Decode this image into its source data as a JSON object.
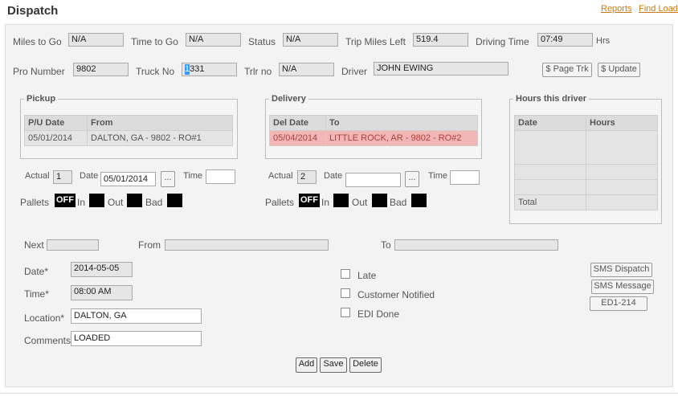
{
  "header": {
    "title": "Dispatch",
    "reports_link": "Reports",
    "find_load_link": "Find Load"
  },
  "summary": {
    "miles_to_go_label": "Miles to Go",
    "miles_to_go": "N/A",
    "time_to_go_label": "Time to Go",
    "time_to_go": "N/A",
    "status_label": "Status",
    "status": "N/A",
    "trip_miles_left_label": "Trip Miles Left",
    "trip_miles_left": "519.4",
    "driving_time_label": "Driving Time",
    "driving_time": "07:49",
    "driving_time_unit": "Hrs",
    "pro_number_label": "Pro Number",
    "pro_number": "9802",
    "truck_no_label": "Truck No",
    "truck_no_first": "1",
    "truck_no_rest": "331",
    "trlr_no_label": "Trlr no",
    "trlr_no": "N/A",
    "driver_label": "Driver",
    "driver": "JOHN EWING",
    "page_trk_button": "$ Page Trk",
    "update_button": "$ Update"
  },
  "pickup": {
    "legend": "Pickup",
    "col_date": "P/U Date",
    "col_from": "From",
    "row": {
      "date": "05/01/2014",
      "from": "DALTON, GA - 9802 - RO#1"
    },
    "actual_label": "Actual",
    "actual": "1",
    "date_label": "Date",
    "date": "05/01/2014",
    "picker_button": "...",
    "time_label": "Time",
    "time": "",
    "pallets_label": "Pallets",
    "off_text": "OFF",
    "in_label": "In",
    "out_label": "Out",
    "bad_label": "Bad"
  },
  "delivery": {
    "legend": "Delivery",
    "col_date": "Del Date",
    "col_to": "To",
    "row": {
      "date": "05/04/2014",
      "to": "LITTLE ROCK, AR - 9802 - RO#2"
    },
    "actual_label": "Actual",
    "actual": "2",
    "date_label": "Date",
    "date": "",
    "picker_button": "...",
    "time_label": "Time",
    "time": "",
    "pallets_label": "Pallets",
    "off_text": "OFF",
    "in_label": "In",
    "out_label": "Out",
    "bad_label": "Bad"
  },
  "hours": {
    "legend": "Hours this driver",
    "col_date": "Date",
    "col_hours": "Hours",
    "total_label": "Total"
  },
  "next": {
    "next_label": "Next",
    "next_value": "",
    "from_label": "From",
    "from_value": "",
    "to_label": "To",
    "to_value": ""
  },
  "entry": {
    "date_label": "Date*",
    "date": "2014-05-05",
    "time_label": "Time*",
    "time": "08:00 AM",
    "location_label": "Location*",
    "location": "DALTON, GA",
    "comments_label": "Comments",
    "comments": "LOADED"
  },
  "checks": {
    "late": "Late",
    "customer_notified": "Customer Notified",
    "edi_done": "EDI Done"
  },
  "side_buttons": {
    "sms_dispatch": "SMS Dispatch",
    "sms_message": "SMS Message",
    "edi": "ED1-214"
  },
  "actions": {
    "add": "Add",
    "save": "Save",
    "delete": "Delete"
  }
}
